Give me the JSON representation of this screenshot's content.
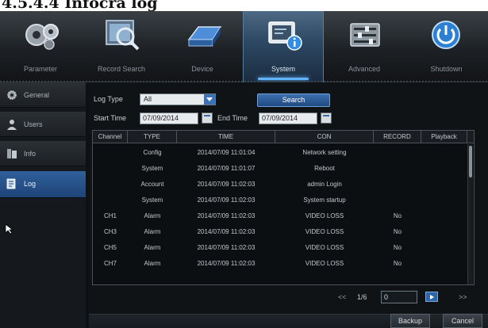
{
  "heading": "4.5.4.4 Infocra log",
  "toolbar": {
    "items": [
      {
        "label": "Parameter",
        "icon": "gears-icon"
      },
      {
        "label": "Record Search",
        "icon": "magnifier-icon"
      },
      {
        "label": "Device",
        "icon": "hard-drive-icon"
      },
      {
        "label": "System",
        "icon": "system-info-icon"
      },
      {
        "label": "Advanced",
        "icon": "advanced-settings-icon"
      },
      {
        "label": "Shutdown",
        "icon": "power-icon"
      }
    ],
    "active": "System",
    "accent_color": "#63b4ff"
  },
  "sidebar": {
    "items": [
      {
        "label": "General",
        "icon": "gear-icon"
      },
      {
        "label": "Users",
        "icon": "user-icon"
      },
      {
        "label": "Info",
        "icon": "info-icon"
      },
      {
        "label": "Log",
        "icon": "log-icon"
      }
    ],
    "active": "Log"
  },
  "filters": {
    "log_type_label": "Log Type",
    "log_type_value": "All",
    "search_label": "Search",
    "start_time_label": "Start Time",
    "start_time_value": "07/09/2014",
    "end_time_label": "End Time",
    "end_time_value": "07/09/2014"
  },
  "table": {
    "columns": [
      "Channel",
      "TYPE",
      "TIME",
      "CON",
      "RECORD",
      "Playback"
    ],
    "rows": [
      [
        "",
        "Config",
        "2014/07/09 11:01:04",
        "Network setting",
        "",
        ""
      ],
      [
        "",
        "System",
        "2014/07/09 11:01:07",
        "Reboot",
        "",
        ""
      ],
      [
        "",
        "Account",
        "2014/07/09 11:02:03",
        "admin Login",
        "",
        ""
      ],
      [
        "",
        "System",
        "2014/07/09 11:02:03",
        "System startup",
        "",
        ""
      ],
      [
        "CH1",
        "Alarm",
        "2014/07/09 11:02:03",
        "VIDEO LOSS",
        "No",
        ""
      ],
      [
        "CH3",
        "Alarm",
        "2014/07/09 11:02:03",
        "VIDEO LOSS",
        "No",
        ""
      ],
      [
        "CH5",
        "Alarm",
        "2014/07/09 11:02:03",
        "VIDEO LOSS",
        "No",
        ""
      ],
      [
        "CH7",
        "Alarm",
        "2014/07/09 11:02:03",
        "VIDEO LOSS",
        "No",
        ""
      ]
    ]
  },
  "pager": {
    "prev": "<<",
    "page": "1/6",
    "input_value": "0",
    "next": ">>"
  },
  "footer": {
    "backup_label": "Backup",
    "cancel_label": "Cancel"
  }
}
